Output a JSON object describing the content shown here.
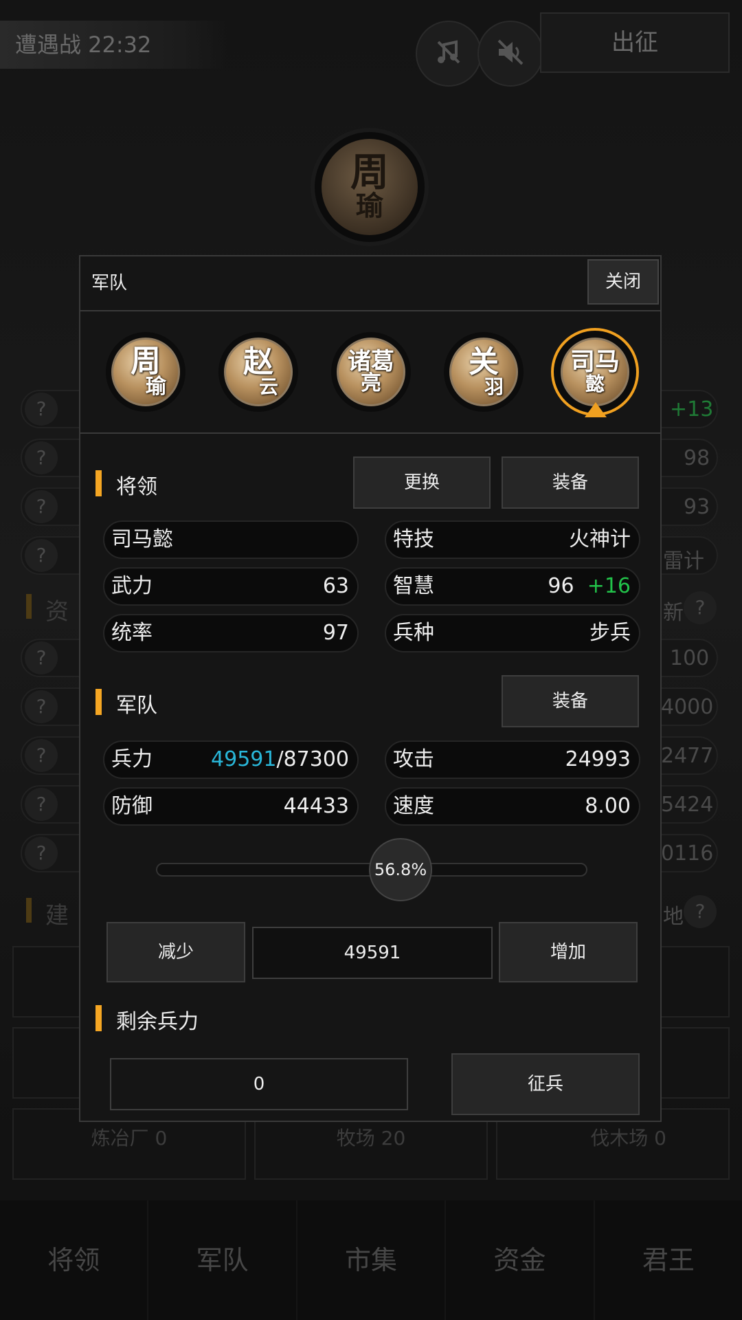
{
  "topbar": {
    "battle_label": "遭遇战 22:32",
    "music_icon": "music-off-icon",
    "sound_icon": "sound-off-icon",
    "march_label": "出征"
  },
  "background": {
    "current_general": [
      "周",
      "瑜"
    ],
    "right_values": [
      "+13",
      "98",
      "93",
      "雷计",
      "100",
      "4000",
      "2477",
      "5424",
      "0116"
    ],
    "section_right_1": "新",
    "section_right_2": "地",
    "buildings": [
      "炼冶厂 0",
      "牧场 20",
      "伐木场 0"
    ]
  },
  "bottom_nav": [
    "将领",
    "军队",
    "市集",
    "资金",
    "君王"
  ],
  "modal": {
    "title": "军队",
    "close_label": "关闭",
    "generals": [
      {
        "line1": "周",
        "line2": "瑜"
      },
      {
        "line1": "赵",
        "line2": "云"
      },
      {
        "line1": "诸葛",
        "line2": "亮"
      },
      {
        "line1": "关",
        "line2": "羽"
      },
      {
        "line1": "司马",
        "line2": "懿"
      }
    ],
    "selected_general_index": 4,
    "general_section": {
      "label": "将领",
      "replace_label": "更换",
      "equip_label": "装备",
      "name": "司马懿",
      "skill_key": "特技",
      "skill_value": "火神计",
      "force_key": "武力",
      "force_value": "63",
      "wisdom_key": "智慧",
      "wisdom_value": "96",
      "wisdom_bonus": "+16",
      "command_key": "统率",
      "command_value": "97",
      "troop_type_key": "兵种",
      "troop_type_value": "步兵"
    },
    "army_section": {
      "label": "军队",
      "equip_label": "装备",
      "troops_key": "兵力",
      "troops_current": "49591",
      "troops_max": "/87300",
      "attack_key": "攻击",
      "attack_value": "24993",
      "defense_key": "防御",
      "defense_value": "44433",
      "speed_key": "速度",
      "speed_value": "8.00",
      "slider_label": "56.8%",
      "slider_fraction": 0.568,
      "decrease_label": "减少",
      "amount_value": "49591",
      "increase_label": "增加"
    },
    "remaining_section": {
      "label": "剩余兵力",
      "value": "0",
      "recruit_label": "征兵"
    }
  },
  "colors": {
    "accent": "#f5a623",
    "selected_ring": "#f0a020",
    "troops_current": "#29b6d8",
    "bonus": "#22c34a"
  }
}
